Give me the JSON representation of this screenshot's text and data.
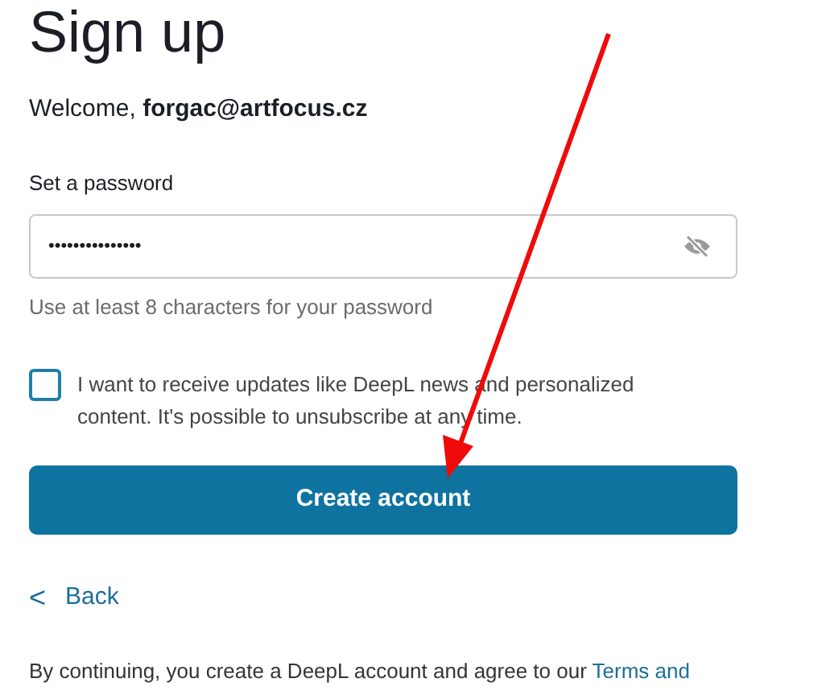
{
  "title": "Sign up",
  "welcome": "Welcome, **forgac@artfocus.cz**",
  "password": {
    "label": "Set a password",
    "value": "•••••••••••••••",
    "hint": "Use at least 8 characters for your password"
  },
  "updates": {
    "label": "I want to receive updates like DeepL news and personalized content. It's possible to unsubscribe at any time.",
    "checked": false
  },
  "create_button": "Create account",
  "back_link": {
    "icon": "<",
    "label": "Back"
  },
  "legal": {
    "text": "By continuing, you create a DeepL account and agree to our ",
    "link": "Terms and"
  }
}
